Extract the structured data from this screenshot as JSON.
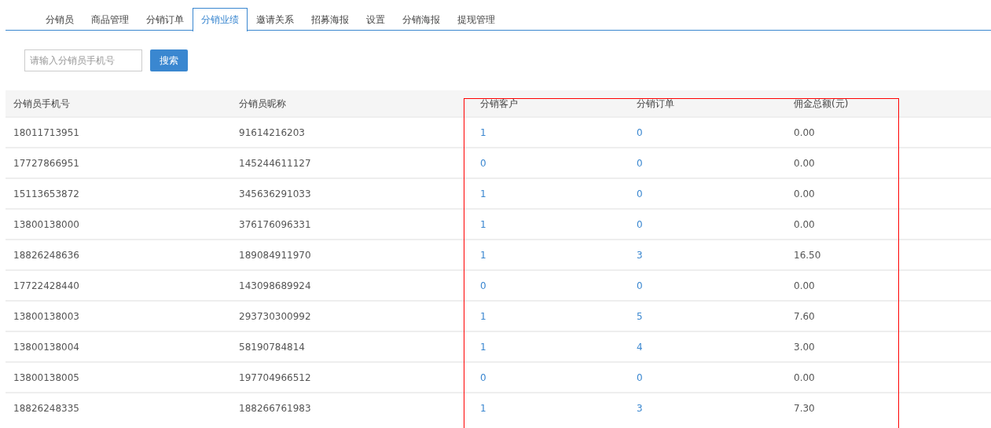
{
  "tabs": [
    {
      "label": "分销员",
      "selected": false
    },
    {
      "label": "商品管理",
      "selected": false
    },
    {
      "label": "分销订单",
      "selected": false
    },
    {
      "label": "分销业绩",
      "selected": true
    },
    {
      "label": "邀请关系",
      "selected": false
    },
    {
      "label": "招募海报",
      "selected": false
    },
    {
      "label": "设置",
      "selected": false
    },
    {
      "label": "分销海报",
      "selected": false
    },
    {
      "label": "提现管理",
      "selected": false
    }
  ],
  "search": {
    "placeholder": "请输入分销员手机号",
    "button": "搜索"
  },
  "table": {
    "columns": [
      {
        "label": "分销员手机号",
        "kind": "text",
        "highlighted": false
      },
      {
        "label": "分销员昵称",
        "kind": "text",
        "highlighted": false
      },
      {
        "label": "分销客户",
        "kind": "link",
        "highlighted": true
      },
      {
        "label": "分销订单",
        "kind": "link",
        "highlighted": true
      },
      {
        "label": "佣金总额(元)",
        "kind": "text",
        "highlighted": true
      }
    ],
    "rows": [
      [
        "18011713951",
        "91614216203",
        "1",
        "0",
        "0.00"
      ],
      [
        "17727866951",
        "145244611127",
        "0",
        "0",
        "0.00"
      ],
      [
        "15113653872",
        "345636291033",
        "1",
        "0",
        "0.00"
      ],
      [
        "13800138000",
        "376176096331",
        "1",
        "0",
        "0.00"
      ],
      [
        "18826248636",
        "189084911970",
        "1",
        "3",
        "16.50"
      ],
      [
        "17722428440",
        "143098689924",
        "0",
        "0",
        "0.00"
      ],
      [
        "13800138003",
        "293730300992",
        "1",
        "5",
        "7.60"
      ],
      [
        "13800138004",
        "58190784814",
        "1",
        "4",
        "3.00"
      ],
      [
        "13800138005",
        "197704966512",
        "0",
        "0",
        "0.00"
      ],
      [
        "18826248335",
        "188266761983",
        "1",
        "3",
        "7.30"
      ]
    ]
  }
}
